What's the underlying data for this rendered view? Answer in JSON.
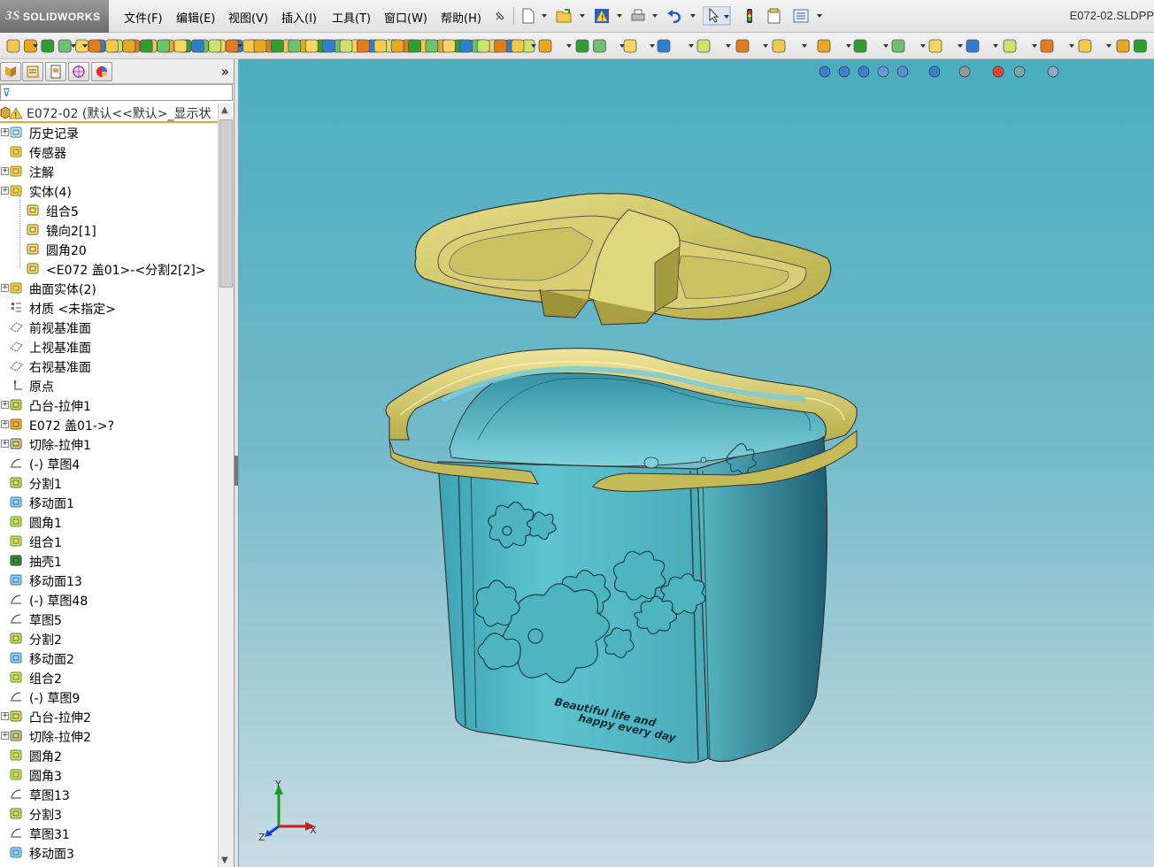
{
  "app": {
    "name": "SOLIDWORKS",
    "document_title": "E072-02.SLDPP"
  },
  "menu": {
    "items": [
      "文件(F)",
      "编辑(E)",
      "视图(V)",
      "插入(I)",
      "工具(T)",
      "窗口(W)",
      "帮助(H)"
    ]
  },
  "feature_manager": {
    "tabs": [
      "feature-tree-tab-icon",
      "property-tab-icon",
      "config-tab-icon",
      "dimxpert-tab-icon",
      "display-tab-icon"
    ],
    "expand_symbol": "»",
    "filter_symbol": "⊽",
    "root_label": "E072-02  (默认<<默认>_显示状",
    "tree": [
      {
        "label": "历史记录",
        "icon": "history-icon",
        "indent": 0,
        "expandable": true
      },
      {
        "label": "传感器",
        "icon": "sensor-icon",
        "indent": 0,
        "expandable": false
      },
      {
        "label": "注解",
        "icon": "annotation-icon",
        "indent": 0,
        "expandable": true
      },
      {
        "label": "实体(4)",
        "icon": "solid-bodies-folder-icon",
        "indent": 0,
        "expandable": true
      },
      {
        "label": "组合5",
        "icon": "body-icon",
        "indent": 1,
        "expandable": false
      },
      {
        "label": "镜向2[1]",
        "icon": "body-icon",
        "indent": 1,
        "expandable": false
      },
      {
        "label": "圆角20",
        "icon": "body-icon",
        "indent": 1,
        "expandable": false
      },
      {
        "label": "<E072 盖01>-<分割2[2]>",
        "icon": "body-icon",
        "indent": 1,
        "expandable": false
      },
      {
        "label": "曲面实体(2)",
        "icon": "surface-bodies-icon",
        "indent": 0,
        "expandable": true
      },
      {
        "label": "材质 <未指定>",
        "icon": "material-icon",
        "indent": 0,
        "expandable": false
      },
      {
        "label": "前视基准面",
        "icon": "plane-icon",
        "indent": 0,
        "expandable": false
      },
      {
        "label": "上视基准面",
        "icon": "plane-icon",
        "indent": 0,
        "expandable": false
      },
      {
        "label": "右视基准面",
        "icon": "plane-icon",
        "indent": 0,
        "expandable": false
      },
      {
        "label": "原点",
        "icon": "origin-icon",
        "indent": 0,
        "expandable": false
      },
      {
        "label": "凸台-拉伸1",
        "icon": "boss-extrude-icon",
        "indent": 0,
        "expandable": true
      },
      {
        "label": "E072 盖01->?",
        "icon": "derived-part-icon",
        "indent": 0,
        "expandable": true
      },
      {
        "label": "切除-拉伸1",
        "icon": "cut-extrude-icon",
        "indent": 0,
        "expandable": true
      },
      {
        "label": "(-) 草图4",
        "icon": "sketch-icon",
        "indent": 0,
        "expandable": false
      },
      {
        "label": "分割1",
        "icon": "split-icon",
        "indent": 0,
        "expandable": false
      },
      {
        "label": "移动面1",
        "icon": "move-face-icon",
        "indent": 0,
        "expandable": false
      },
      {
        "label": "圆角1",
        "icon": "fillet-icon",
        "indent": 0,
        "expandable": false
      },
      {
        "label": "组合1",
        "icon": "combine-icon",
        "indent": 0,
        "expandable": false
      },
      {
        "label": "抽壳1",
        "icon": "shell-icon",
        "indent": 0,
        "expandable": false
      },
      {
        "label": "移动面13",
        "icon": "move-face-icon",
        "indent": 0,
        "expandable": false
      },
      {
        "label": "(-) 草图48",
        "icon": "sketch-icon",
        "indent": 0,
        "expandable": false
      },
      {
        "label": "草图5",
        "icon": "sketch-icon",
        "indent": 0,
        "expandable": false
      },
      {
        "label": "分割2",
        "icon": "split-icon",
        "indent": 0,
        "expandable": false
      },
      {
        "label": "移动面2",
        "icon": "move-face-icon",
        "indent": 0,
        "expandable": false
      },
      {
        "label": "组合2",
        "icon": "combine-icon",
        "indent": 0,
        "expandable": false
      },
      {
        "label": "(-) 草图9",
        "icon": "sketch-icon",
        "indent": 0,
        "expandable": false
      },
      {
        "label": "凸台-拉伸2",
        "icon": "boss-extrude-icon",
        "indent": 0,
        "expandable": true
      },
      {
        "label": "切除-拉伸2",
        "icon": "cut-extrude-icon",
        "indent": 0,
        "expandable": true
      },
      {
        "label": "圆角2",
        "icon": "fillet-icon",
        "indent": 0,
        "expandable": false
      },
      {
        "label": "圆角3",
        "icon": "fillet-icon",
        "indent": 0,
        "expandable": false
      },
      {
        "label": "草图13",
        "icon": "sketch-icon",
        "indent": 0,
        "expandable": false
      },
      {
        "label": "分割3",
        "icon": "split-icon",
        "indent": 0,
        "expandable": false
      },
      {
        "label": "草图31",
        "icon": "sketch-icon",
        "indent": 0,
        "expandable": false
      },
      {
        "label": "移动面3",
        "icon": "move-face-icon",
        "indent": 0,
        "expandable": false
      }
    ]
  },
  "viewport": {
    "model_text_line1": "Beautiful life and",
    "model_text_line2": "happy every day",
    "triad": {
      "x": "X",
      "y": "Y",
      "z": "Z"
    }
  },
  "colors": {
    "viewport_top": "#4aaec0",
    "viewport_bottom": "#c9dbe2",
    "lid_color": "#c9bf62",
    "basket_color": "#58b8c4",
    "selection_accent": "#e7a33c"
  }
}
